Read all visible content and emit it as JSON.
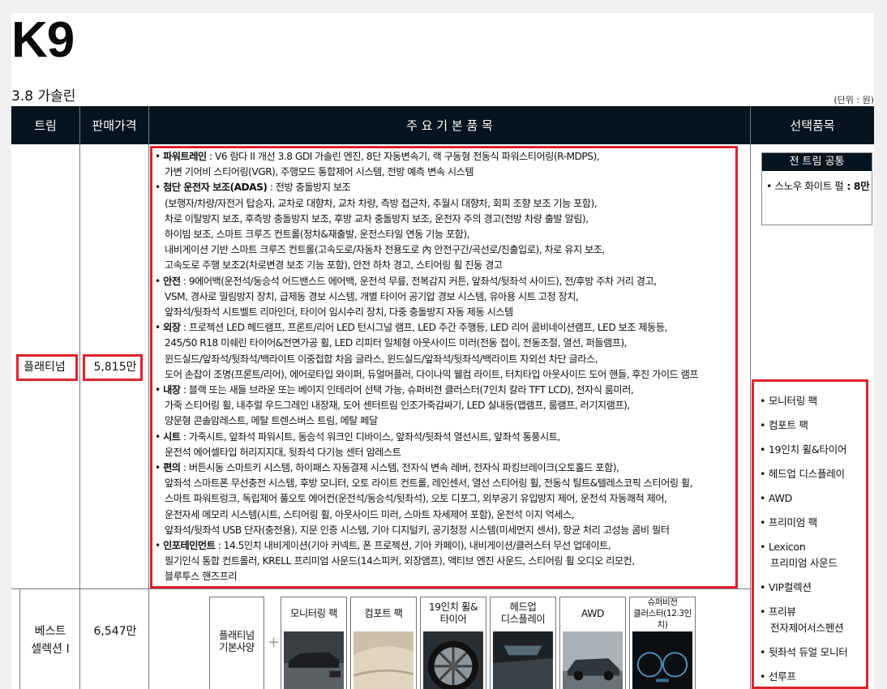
{
  "header": {
    "model": "K9",
    "engine": "3.8 가솔린",
    "unit_note": "(단위 : 원)"
  },
  "table": {
    "columns": [
      "트림",
      "판매가격",
      "주 요 기 본 품 목",
      "선택품목"
    ],
    "rows": [
      {
        "trim": "플래티넘",
        "price": "5,815만"
      },
      {
        "trim_line1": "베스트",
        "trim_line2": "셀렉션 Ⅰ",
        "price": "6,547만"
      }
    ]
  },
  "features": [
    {
      "category": "파워트레인",
      "lines": [
        " : V6 람다 II 개선 3.8 GDI 가솔린 엔진, 8단 자동변속기, 랙 구동형 전동식 파워스티어링(R-MDPS),",
        "가변 기어비 스티어링(VGR), 주행모드 통합제어 시스템, 전방 예측 변속 시스템"
      ]
    },
    {
      "category": "첨단 운전자 보조(ADAS)",
      "lines": [
        " : 전방 충돌방지 보조",
        "(보행자/차량/자전거 탑승자, 교차로 대향차, 교차 차량, 측방 접근차, 추월시 대향차, 회피 조향 보조 기능 포함),",
        "차로 이탈방지 보조, 후측방 충돌방지 보조, 후방 교차 충돌방지 보조, 운전자 주의 경고(전방 차량 출발 알림),",
        "하이빔 보조, 스마트 크루즈 컨트롤(정차&재출발, 운전스타일 연동 기능 포함),",
        "내비게이션 기반 스마트 크루즈 컨트롤(고속도로/자동차 전용도로 內 안전구간/곡선로/진출입로), 차로 유지 보조,",
        "고속도로 주행 보조2(차로변경 보조 기능 포함), 안전 하차 경고, 스티어링 휠 진동 경고"
      ]
    },
    {
      "category": "안전",
      "lines": [
        " : 9에어백(운전석/동승석 어드밴스드 에어백, 운전석 무릎, 전복감지 커튼, 앞좌석/뒷좌석 사이드), 전/후방 주차 거리 경고,",
        "VSM, 경사로 밀림방지 장치, 급제동 경보 시스템, 개별 타이어 공기압 경보 시스템, 유아용 시트 고정 장치,",
        "앞좌석/뒷좌석 시트벨트 리마인더, 타이어 임시수리 장치, 다중 충돌방지 자동 제동 시스템"
      ]
    },
    {
      "category": "외장",
      "lines": [
        " : 프로젝션 LED 헤드램프, 프론트/리어 LED 턴시그널 램프, LED 주간 주행등, LED 리어 콤비네이션램프, LED 보조 제동등,",
        "245/50 R18 미쉐린 타이어&전면가공 휠, LED 리피터 일체형 아웃사이드 미러(전동 접이, 전동조절, 열선, 퍼들램프),",
        "윈드실드/앞좌석/뒷좌석/백라이트 이중접합 차음 글라스, 윈드실드/앞좌석/뒷좌석/백라이트 자외선 차단 글라스,",
        "도어 손잡이 조명(프론트/리어), 에어로타입 와이퍼, 듀얼머플러, 다이나믹 웰컴 라이트, 터치타입 아웃사이드 도어 핸들, 후진 가이드 램프"
      ]
    },
    {
      "category": "내장",
      "lines": [
        " : 블랙 또는 새들 브라운 또는 베이지 인테리어 선택 가능, 슈퍼비전 클러스터(7인치 칼라 TFT LCD), 전자식 룸미러,",
        "가죽 스티어링 휠, 내추럴 우드그레인 내장재, 도어 센터트림 인조가죽감싸기, LED 실내등(맵램프, 룸램프, 러기지램프),",
        "양문형 콘솔암레스트, 메탈 트렌스버스 트림, 메탈 페달"
      ]
    },
    {
      "category": "시트",
      "lines": [
        " : 가죽시트, 앞좌석 파워시트, 동승석 워크인 디바이스, 앞좌석/뒷좌석 열선시트, 앞좌석 통풍시트,",
        "운전석 에어셀타입 허리지지대, 뒷좌석 다기능 센터 암레스트"
      ]
    },
    {
      "category": "편의",
      "lines": [
        " : 버튼시동 스마트키 시스템, 하이패스 자동결제 시스템, 전자식 변속 레버, 전자식 파킹브레이크(오토홀드 포함),",
        "앞좌석 스마트폰 무선충전 시스템, 후방 모니터, 오토 라이트 컨트롤, 레인센서, 열선 스티어링 휠, 전동식 틸트&텔레스코픽 스티어링 휠,",
        "스마트 파워트렁크, 독립제어 풀오토 에어컨(운전석/동승석/뒷좌석), 오토 디포그, 외부공기 유입방지 제어, 운전석 자동쾌적 제어,",
        "운전자세 메모리 시스템(시트, 스티어링 휠, 아웃사이드 미러, 스마트 자세제어 포함), 운전석 이지 억세스,",
        "앞좌석/뒷좌석 USB 단자(충전용), 지문 인증 시스템, 기아 디지털키, 공기청정 시스템(미세먼지 센서), 항균 처리 고성능 콤비 필터"
      ]
    },
    {
      "category": "인포테인먼트",
      "lines": [
        " : 14.5인치 내비게이션(기아 커넥트, 폰 프로젝션, 기아 카페이), 내비게이션/클러스터 무선 업데이트,",
        "필기인식 통합 컨트롤러, KRELL 프리미엄 사운드(14스피커, 외장앰프), 액티브 엔진 사운드, 스티어링 휠 오디오 리모컨,",
        "블루투스 핸즈프리"
      ]
    }
  ],
  "common_options": {
    "title": "전 트림 공통",
    "item_label": "• 스노우 화이트 펄",
    "item_price": " : 8만"
  },
  "options": [
    "• 모니터링 팩",
    "• 컴포트 팩",
    "• 19인치 휠&타이어",
    "• 헤드업 디스플레이",
    "• AWD",
    "• 프리미엄 팩",
    "• Lexicon",
    "프리미엄 사운드",
    "• VIP컬렉션",
    "• 프리뷰",
    "전자제어서스펜션",
    "• 뒷좌석 듀얼 모니터",
    "• 선루프"
  ],
  "package_cards": [
    {
      "line1": "플래티넘",
      "line2": "기본사양"
    },
    {
      "line1": "모니터링 팩",
      "line2": ""
    },
    {
      "line1": "컴포트 팩",
      "line2": ""
    },
    {
      "line1": "19인치 휠&",
      "line2": "타이어"
    },
    {
      "line1": "헤드업",
      "line2": "디스플레이"
    },
    {
      "line1": "AWD",
      "line2": ""
    },
    {
      "line1": "슈퍼비전",
      "line2": "클러스터(12.3인치)"
    }
  ],
  "plus_sign": "+",
  "colors": {
    "header_bg": "#05141f",
    "highlight": "#e0222c"
  }
}
